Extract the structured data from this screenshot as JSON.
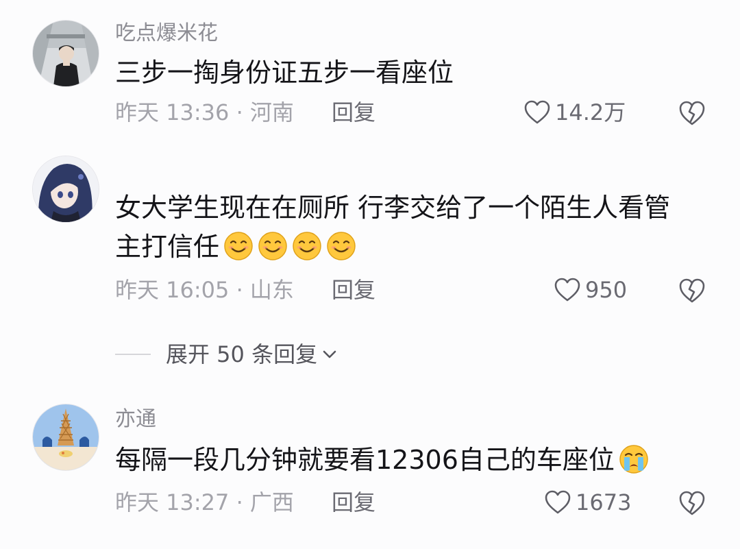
{
  "comments": [
    {
      "username": "吃点爆米花",
      "text": "三步一掏身份证五步一看座位",
      "emojis": [],
      "meta": "昨天 13:36 · 河南",
      "reply_label": "回复",
      "likes": "14.2万",
      "avatar_icon": "person-photo-avatar"
    },
    {
      "username": "",
      "text": "女大学生现在在厕所 行李交给了一个陌生人看管 主打信任",
      "emojis": [
        "grin-emoji",
        "grin-emoji",
        "grin-emoji",
        "grin-emoji"
      ],
      "meta": "昨天 16:05 · 山东",
      "reply_label": "回复",
      "likes": "950",
      "avatar_icon": "anime-girl-avatar"
    },
    {
      "username": "亦通",
      "text": "每隔一段几分钟就要看12306自己的车座位",
      "emojis": [
        "crying-emoji"
      ],
      "meta": "昨天 13:27 · 广西",
      "reply_label": "回复",
      "likes": "1673",
      "avatar_icon": "ice-cream-cone-avatar"
    }
  ],
  "expand_replies": {
    "label": "展开 50 条回复",
    "icon": "chevron-down-icon"
  },
  "colors": {
    "background": "#fcfcfd",
    "username": "#8c8c93",
    "content": "#141418",
    "meta": "#a3a3aa",
    "emoji_face": "#ffc83d"
  }
}
